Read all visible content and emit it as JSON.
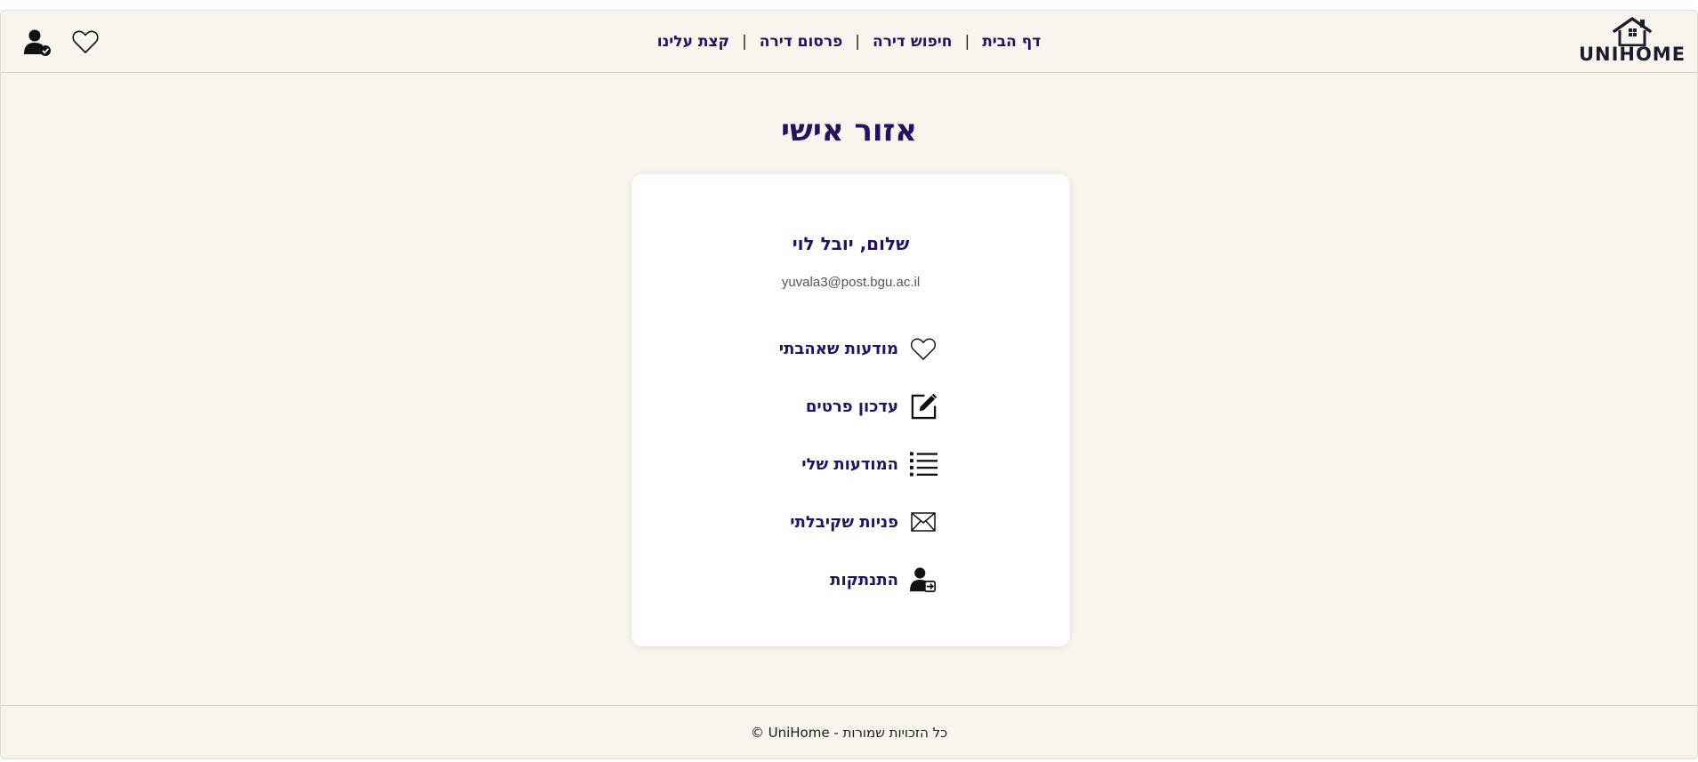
{
  "brand": {
    "name": "UNIHOME",
    "logo_icon": "house-icon"
  },
  "nav": {
    "items": [
      {
        "label": "דף הבית"
      },
      {
        "label": "חיפוש דירה"
      },
      {
        "label": "פרסום דירה"
      },
      {
        "label": "קצת עלינו"
      }
    ],
    "separator": "|"
  },
  "header_icons": {
    "favorites": "heart-icon",
    "account": "user-check-icon"
  },
  "page": {
    "title": "אזור אישי"
  },
  "profile": {
    "greeting": "שלום, יובל לוי",
    "email": "yuvala3@post.bgu.ac.il"
  },
  "menu": [
    {
      "label": "מודעות שאהבתי",
      "icon": "heart-icon"
    },
    {
      "label": "עדכון פרטים",
      "icon": "edit-icon"
    },
    {
      "label": "המודעות שלי",
      "icon": "list-icon"
    },
    {
      "label": "פניות שקיבלתי",
      "icon": "envelope-icon"
    },
    {
      "label": "התנתקות",
      "icon": "logout-user-icon"
    }
  ],
  "footer": {
    "text": "© UniHome - כל הזכויות שמורות"
  },
  "colors": {
    "accent": "#24125f",
    "background": "#f9f5ee",
    "card": "#ffffff"
  }
}
